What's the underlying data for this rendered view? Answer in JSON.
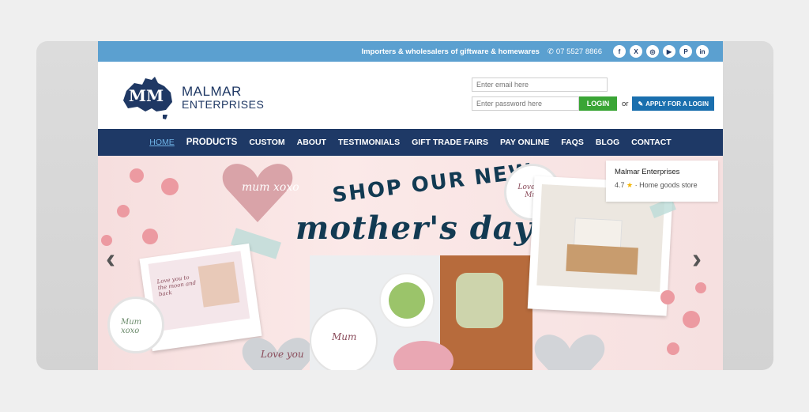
{
  "topbar": {
    "tagline": "Importers & wholesalers of giftware & homewares",
    "phone": "07 5527 8866",
    "social": [
      {
        "icon": "facebook-icon",
        "glyph": "f"
      },
      {
        "icon": "x-twitter-icon",
        "glyph": "X"
      },
      {
        "icon": "instagram-icon",
        "glyph": "◎"
      },
      {
        "icon": "youtube-icon",
        "glyph": "▶"
      },
      {
        "icon": "pinterest-icon",
        "glyph": "P"
      },
      {
        "icon": "linkedin-icon",
        "glyph": "in"
      }
    ]
  },
  "brand": {
    "line1": "MALMAR",
    "line2": "ENTERPRISES",
    "mark": "MM"
  },
  "login": {
    "email_placeholder": "Enter email here",
    "password_placeholder": "Enter password here",
    "login_label": "LOGIN",
    "or": "or",
    "apply_label": "APPLY FOR A LOGIN"
  },
  "nav": [
    "HOME",
    "PRODUCTS",
    "CUSTOM",
    "ABOUT",
    "TESTIMONIALS",
    "GIFT TRADE FAIRS",
    "PAY ONLINE",
    "FAQS",
    "BLOG",
    "CONTACT"
  ],
  "hero": {
    "line1": "SHOP OUR NEW",
    "line2": "mother's day",
    "prev": "‹",
    "next": "›",
    "tag1": "mum xoxo",
    "tag2": "Love you",
    "coaster1": "Love you Mum",
    "coaster2": "Mum xoxo",
    "coaster3": "Mum",
    "frame_text": "Love you to the moon and back"
  },
  "google_card": {
    "name": "Malmar Enterprises",
    "rating": "4.7",
    "star": "★",
    "category": "· Home goods store"
  },
  "colors": {
    "topbar": "#5ba0d0",
    "nav": "#1e3966",
    "login_green": "#3aa535",
    "apply_blue": "#1a6fae",
    "brand_navy": "#1f3864"
  }
}
